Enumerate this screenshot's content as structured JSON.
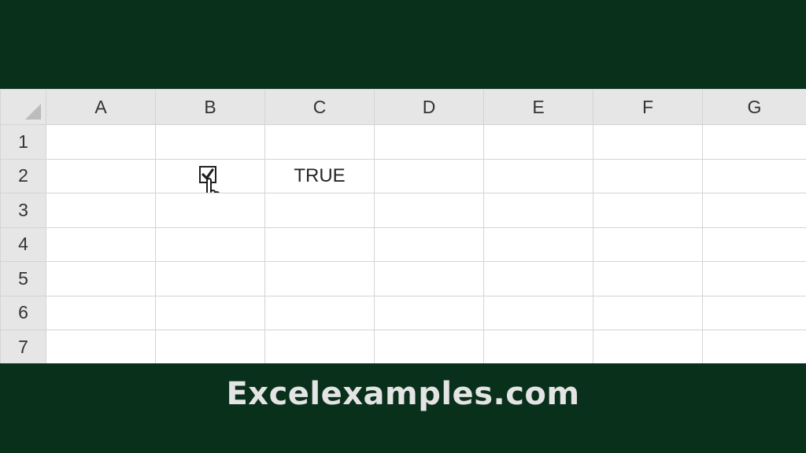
{
  "columns": [
    "A",
    "B",
    "C",
    "D",
    "E",
    "F",
    "G"
  ],
  "rows": [
    "1",
    "2",
    "3",
    "4",
    "5",
    "6",
    "7"
  ],
  "cells": {
    "B2": {
      "type": "checkbox",
      "checked": true
    },
    "C2": "TRUE"
  },
  "icons": {
    "corner": "select-all-triangle-icon",
    "checkbox": "checkbox-checked-icon",
    "cursor": "hand-pointer-cursor-icon"
  },
  "footer": {
    "text": "Excelexamples.com"
  },
  "colors": {
    "banner_bg": "#08301b",
    "header_bg": "#e6e6e6",
    "gridline": "#d4d4d4",
    "footer_text": "#e4e4e4"
  }
}
